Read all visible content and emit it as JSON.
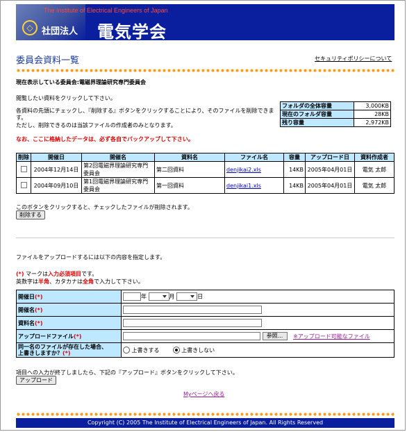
{
  "header": {
    "org_en": "The Institute of Electrical Engineers of Japan",
    "org_prefix": "社団法人",
    "org_jp": "電気学会",
    "logo_glyph": "◇"
  },
  "page": {
    "title": "委員会資料一覧",
    "security_link": "セキュリティポリシーについて"
  },
  "committee": {
    "label": "現在表示している委員会:",
    "name": "電磁界理論研究専門委員会"
  },
  "instructions": {
    "click_file": "閲覧したい資料をクリックして下さい。",
    "delete_line1": "各資料の先頭にチェックし、『削除する』ボタンをクリックすることにより、そのファイルを削除できま",
    "delete_line2": "す。",
    "delete_line3": "ただし、削除できるのは当該ファイルの作成者のみとなります。",
    "backup_warning": "なお、ここに格納したデータは、必ず各自でバックアップして下さい。"
  },
  "capacity": {
    "rows": [
      {
        "label": "フォルダの全体容量",
        "value": "3,000KB"
      },
      {
        "label": "現在のフォルダ容量",
        "value": "28KB"
      },
      {
        "label": "残り容量",
        "value": "2,972KB"
      }
    ]
  },
  "files": {
    "headers": [
      "削除",
      "開催日",
      "開催名",
      "資料名",
      "ファイル名",
      "容量",
      "アップロード日",
      "資料作成者"
    ],
    "rows": [
      {
        "date": "2004年12月14日",
        "meeting": "第2回電磁界理論研究専門委員会",
        "material": "第二回資料",
        "filename": "denjikai2.xls",
        "size": "14KB",
        "upload_date": "2005年04月01日",
        "author": "電気 太郎"
      },
      {
        "date": "2004年09月10日",
        "meeting": "第1回電磁界理論研究専門委員会",
        "material": "第一回資料",
        "filename": "denjikai1.xls",
        "size": "14KB",
        "upload_date": "2005年04月01日",
        "author": "電気 太郎"
      }
    ]
  },
  "delete_section": {
    "note": "このボタンをクリックすると、チェックしたファイルが削除されます。",
    "button": "削除する"
  },
  "upload_section": {
    "intro": "ファイルをアップロードするには以下の内容を指定します。",
    "req_mark": "(*)",
    "req_text1": " マークは",
    "req_text2": "入力必須項目",
    "req_text3": "です。",
    "hint1": "英数字は",
    "hint2": "半角",
    "hint3": "、カタカナは",
    "hint4": "全角",
    "hint5": "で入力して下さい。",
    "fields": {
      "date_label": "開催日",
      "year_unit": "年",
      "month_unit": "月",
      "day_unit": "日",
      "meeting_label": "開催名",
      "material_label": "資料名",
      "file_label": "アップロードファイル",
      "browse_button": "参照...",
      "allowed_link": "※アップロード可能なファイル",
      "overwrite_label1": "同一名のファイルが存在した場合、",
      "overwrite_label2": "上書きしますか？",
      "overwrite_yes": "上書きする",
      "overwrite_no": "上書きしない",
      "overwrite_selected": "上書きしない",
      "required_mark": "(*)"
    },
    "after_note": "項目への入力が終了しましたら、下記の『アップロード』ボタンをクリックして下さい。",
    "upload_button": "アップロード"
  },
  "mypage_link": "Myページへ戻る",
  "footer": {
    "copyright": "Copyright (C) 2005 The Institute of Electrical Engineers of Japan. All Rights Reserved"
  },
  "colors": {
    "brand_blue": "#0a1f9e",
    "header_cell": "#bde8ff",
    "warning_red": "#e00000",
    "dot_orange": "#ff9a1a"
  }
}
